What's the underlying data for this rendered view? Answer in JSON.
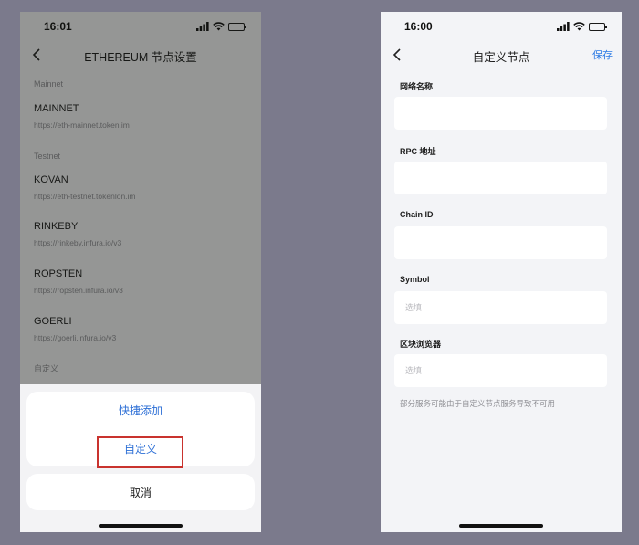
{
  "status": {
    "left_time": "16:01",
    "right_time": "16:00"
  },
  "left": {
    "title": "ETHEREUM 节点设置",
    "mainnet_label": "Mainnet",
    "testnet_label": "Testnet",
    "custom_label": "自定义",
    "nodes": [
      {
        "name": "MAINNET",
        "url": "https://eth-mainnet.token.im"
      },
      {
        "name": "KOVAN",
        "url": "https://eth-testnet.tokenlon.im"
      },
      {
        "name": "RINKEBY",
        "url": "https://rinkeby.infura.io/v3"
      },
      {
        "name": "ROPSTEN",
        "url": "https://ropsten.infura.io/v3"
      },
      {
        "name": "GOERLI",
        "url": "https://goerli.infura.io/v3"
      }
    ],
    "sheet": {
      "quick_add": "快捷添加",
      "custom": "自定义",
      "cancel": "取消"
    }
  },
  "right": {
    "title": "自定义节点",
    "save": "保存",
    "fields": [
      {
        "label": "网络名称",
        "value": "",
        "placeholder": ""
      },
      {
        "label": "RPC 地址",
        "value": "",
        "placeholder": ""
      },
      {
        "label": "Chain ID",
        "value": "",
        "placeholder": ""
      },
      {
        "label": "Symbol",
        "value": "",
        "placeholder": "选填"
      },
      {
        "label": "区块浏览器",
        "value": "",
        "placeholder": "选填"
      }
    ],
    "note": "部分服务可能由于自定义节点服务导致不可用"
  },
  "colors": {
    "background": "#7b7a8c",
    "accent": "#2d7be5",
    "highlight": "#c9332e",
    "battery": "#3ac35b"
  },
  "icons": [
    "back-chevron-icon",
    "signal-icon",
    "wifi-icon",
    "battery-icon"
  ]
}
